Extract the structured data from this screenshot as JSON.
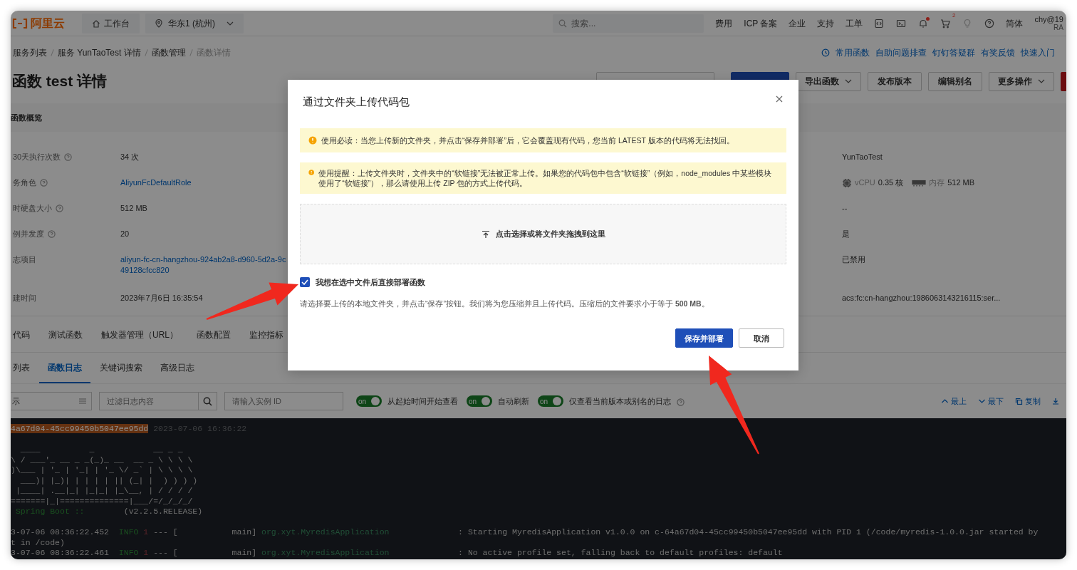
{
  "header": {
    "brand": "阿里云",
    "workbench": "工作台",
    "region": "华东1 (杭州)",
    "search": {
      "placeholder": "搜索..."
    },
    "links": [
      "费用",
      "ICP 备案",
      "企业",
      "支持",
      "工单"
    ],
    "icons": [
      {
        "kind": "code"
      },
      {
        "kind": "terminal"
      },
      {
        "kind": "bell",
        "dot": true
      },
      {
        "kind": "cart",
        "badge": "2"
      },
      {
        "kind": "bulb"
      },
      {
        "kind": "help"
      }
    ],
    "language": "简体",
    "user": "chy@19",
    "user_sub": "RA"
  },
  "breadcrumb": [
    "服务列表",
    "服务 YunTaoTest 详情",
    "函数管理",
    "函数详情"
  ],
  "help_links": [
    "常用函数",
    "自助问题排查",
    "钉钉答疑群",
    "有奖反馈",
    "快速入门"
  ],
  "title": "函数 test 详情",
  "actions": [
    {
      "label": "导出函数",
      "dropdown": true
    },
    {
      "label": "发布版本",
      "dropdown": false
    },
    {
      "label": "编辑别名",
      "dropdown": false
    },
    {
      "label": "更多操作",
      "dropdown": true
    }
  ],
  "overview": {
    "heading": "函数概览",
    "rows": [
      {
        "label": "30天执行次数",
        "help": true,
        "value": [
          "34 次"
        ],
        "link": false
      },
      {
        "label": "务角色",
        "help": true,
        "value": [
          "AliyunFcDefaultRole"
        ],
        "link": true
      },
      {
        "label": "时硬盘大小",
        "help": true,
        "value": [
          "512 MB"
        ],
        "link": false
      },
      {
        "label": "例并发度",
        "help": true,
        "value": [
          "20"
        ],
        "link": false
      },
      {
        "label": "志项目",
        "help": false,
        "value": [
          "aliyun-fc-cn-hangzhou-924ab2a8-d960-5d2a-9c",
          "49128cfcc820"
        ],
        "link": true
      },
      {
        "label": "建时间",
        "help": false,
        "value": [
          "2023年7月6日 16:35:54"
        ],
        "link": false
      }
    ],
    "right_values": [
      {
        "kind": "text",
        "text": "YunTaoTest"
      },
      {
        "kind": "spec",
        "cpu_label": "vCPU",
        "cpu": "0.35 核",
        "mem_label": "内存",
        "mem": "512 MB"
      },
      {
        "kind": "text",
        "text": "--"
      },
      {
        "kind": "text",
        "text": "是"
      },
      {
        "kind": "text",
        "text": "已禁用"
      },
      {
        "kind": "text",
        "text": "acs:fc:cn-hangzhou:1986063143216115:ser..."
      }
    ]
  },
  "tabs": [
    {
      "label": "代码",
      "selected": false
    },
    {
      "label": "测试函数",
      "selected": false
    },
    {
      "label": "触发器管理（URL）",
      "selected": false
    },
    {
      "label": "函数配置",
      "selected": false
    },
    {
      "label": "监控指标",
      "selected": false
    }
  ],
  "subtabs": [
    {
      "label": "列表",
      "selected": false
    },
    {
      "label": "函数日志",
      "selected": true
    },
    {
      "label": "关键词搜索",
      "selected": false
    },
    {
      "label": "高级日志",
      "selected": false
    }
  ],
  "toolbar": {
    "time_field": "示",
    "filter": {
      "placeholder": "过滤日志内容"
    },
    "instance": {
      "placeholder": "请输入实例 ID"
    },
    "toggles": [
      {
        "label": "从起始时间开始查看",
        "on": true,
        "switch_text": "on",
        "help": false
      },
      {
        "label": "自动刷新",
        "on": true,
        "switch_text": "on",
        "help": false
      },
      {
        "label": "仅查看当前版本或别名的日志",
        "on": true,
        "switch_text": "on",
        "help": true
      }
    ],
    "actions": [
      {
        "kind": "up",
        "label": "最上"
      },
      {
        "kind": "down",
        "label": "最下"
      },
      {
        "kind": "copy",
        "label": "复制"
      }
    ]
  },
  "console": {
    "instance": "4a67d04-45cc99450b5047ee95dd",
    "time": "2023-07-06 16:36:22",
    "banner": [
      "  ____          _            __ _ _",
      "\\ / ___'_ __ _ _(_)_ __  __ _ \\ \\ \\ \\",
      ")\\___ | '_ | '_| | '_ \\/ _` | \\ \\ \\ \\",
      "  ___)| |_)| | | | | || (_| |  ) ) ) )",
      " |____| .__|_| |_|_| |_\\__, | / / / /",
      "=======|_|==============|___/=/_/_/_/"
    ],
    "boot": {
      "label": "Spring Boot ::",
      "version": "        (v2.2.5.RELEASE)"
    },
    "logs": [
      {
        "time": "3-07-06 08:36:22.452",
        "level": "INFO",
        "pid": "1",
        "thread": "--- [           main]",
        "logger": "org.xyt.MyredisApplication",
        "message": ": Starting MyredisApplication v1.0.0 on c-64a67d04-45cc99450b5047ee95dd with PID 1 (/code/myredis-1.0.0.jar started by",
        "continuation": "t in /code)"
      },
      {
        "time": "3-07-06 08:36:22.461",
        "level": "INFO",
        "pid": "1",
        "thread": "--- [           main]",
        "logger": "org.xyt.MyredisApplication",
        "message": ": No active profile set, falling back to default profiles: default"
      }
    ]
  },
  "modal": {
    "title": "通过文件夹上传代码包",
    "alerts": [
      "使用必读：当您上传新的文件夹，并点击“保存并部署”后，它会覆盖现有代码，您当前 LATEST 版本的代码将无法找回。",
      "使用提醒：上传文件夹时，文件夹中的“软链接”无法被正常上传。如果您的代码包中包含“软链接”（例如，node_modules 中某些模块使用了“软链接”），那么请使用上传 ZIP 包的方式上传代码。"
    ],
    "dropzone": "点击选择或将文件夹拖拽到这里",
    "checkbox": {
      "label": "我想在选中文件后直接部署函数",
      "checked": true
    },
    "hint": "请选择要上传的本地文件夹，并点击“保存”按钮。我们将为您压缩并且上传代码。压缩后的文件要求小于等于 **500 MB**。",
    "buttons": [
      {
        "label": "保存并部署",
        "primary": true
      },
      {
        "label": "取消",
        "primary": false
      }
    ]
  }
}
